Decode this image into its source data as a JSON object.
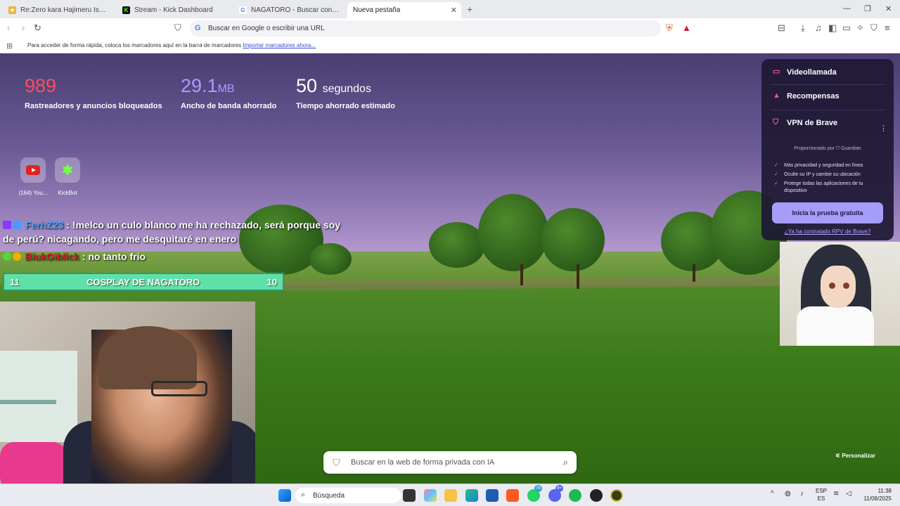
{
  "tabs": [
    {
      "title": "Re:Zero kara Hajimeru Isekai Seikatsu"
    },
    {
      "title": "Stream - Kick Dashboard"
    },
    {
      "title": "NAGATORO - Buscar con Google"
    },
    {
      "title": "Nueva pestaña"
    }
  ],
  "toolbar": {
    "omnibox_placeholder": "Buscar en Google o escribir una URL"
  },
  "bookmarks_bar": {
    "text": "Para acceder de forma rápida, coloca los marcadores aquí en la barra de marcadores",
    "link": "Importar marcadores ahora..."
  },
  "stats": [
    {
      "value": "989",
      "unit": "",
      "label": "Rastreadores y anuncios bloqueados",
      "color": "#ff4d5a"
    },
    {
      "value": "29.1",
      "unit": "MB",
      "label": "Ancho de banda ahorrado",
      "color": "#a99cff"
    },
    {
      "value": "50",
      "unit": "segundos",
      "label": "Tiempo ahorrado estimado",
      "color": "#ffffff"
    }
  ],
  "shortcuts": [
    {
      "label": "(164) You...",
      "icon": "youtube-icon"
    },
    {
      "label": "KickBot",
      "icon": "kickbot-icon"
    }
  ],
  "chat": [
    {
      "user": "FerhZ23",
      "message": ": !melco un culo blanco me ha rechazado, será porque soy de perú? nicagando, pero me desquitaré en enero"
    },
    {
      "user": "BiukGiblick",
      "message": ": no tanto frio"
    }
  ],
  "counter": {
    "left": "11",
    "title": "COSPLAY DE NAGATORO",
    "right": "10"
  },
  "panel": {
    "videollamada": "Videollamada",
    "recompensas": "Recompensas",
    "vpn": "VPN de Brave",
    "provided_by": "Proporcionado por",
    "provider": "Guardian",
    "features": [
      "Más privacidad y seguridad en línea",
      "Oculte su IP y cambie su ubicación",
      "Protege todas las aplicaciones de tu dispositivo"
    ],
    "cta": "Inicia la prueba gratuita",
    "link": "¿Ya ha contratado RPV de Brave?"
  },
  "search": {
    "placeholder": "Buscar en la web de forma privada con IA"
  },
  "customize": "Personalizar",
  "taskbar": {
    "search": "Búsqueda",
    "lang_top": "ESP",
    "lang_bottom": "ES",
    "time": "11:38",
    "date": "11/08/2025",
    "whatsapp_badge": "78",
    "discord_badge": "9+"
  }
}
